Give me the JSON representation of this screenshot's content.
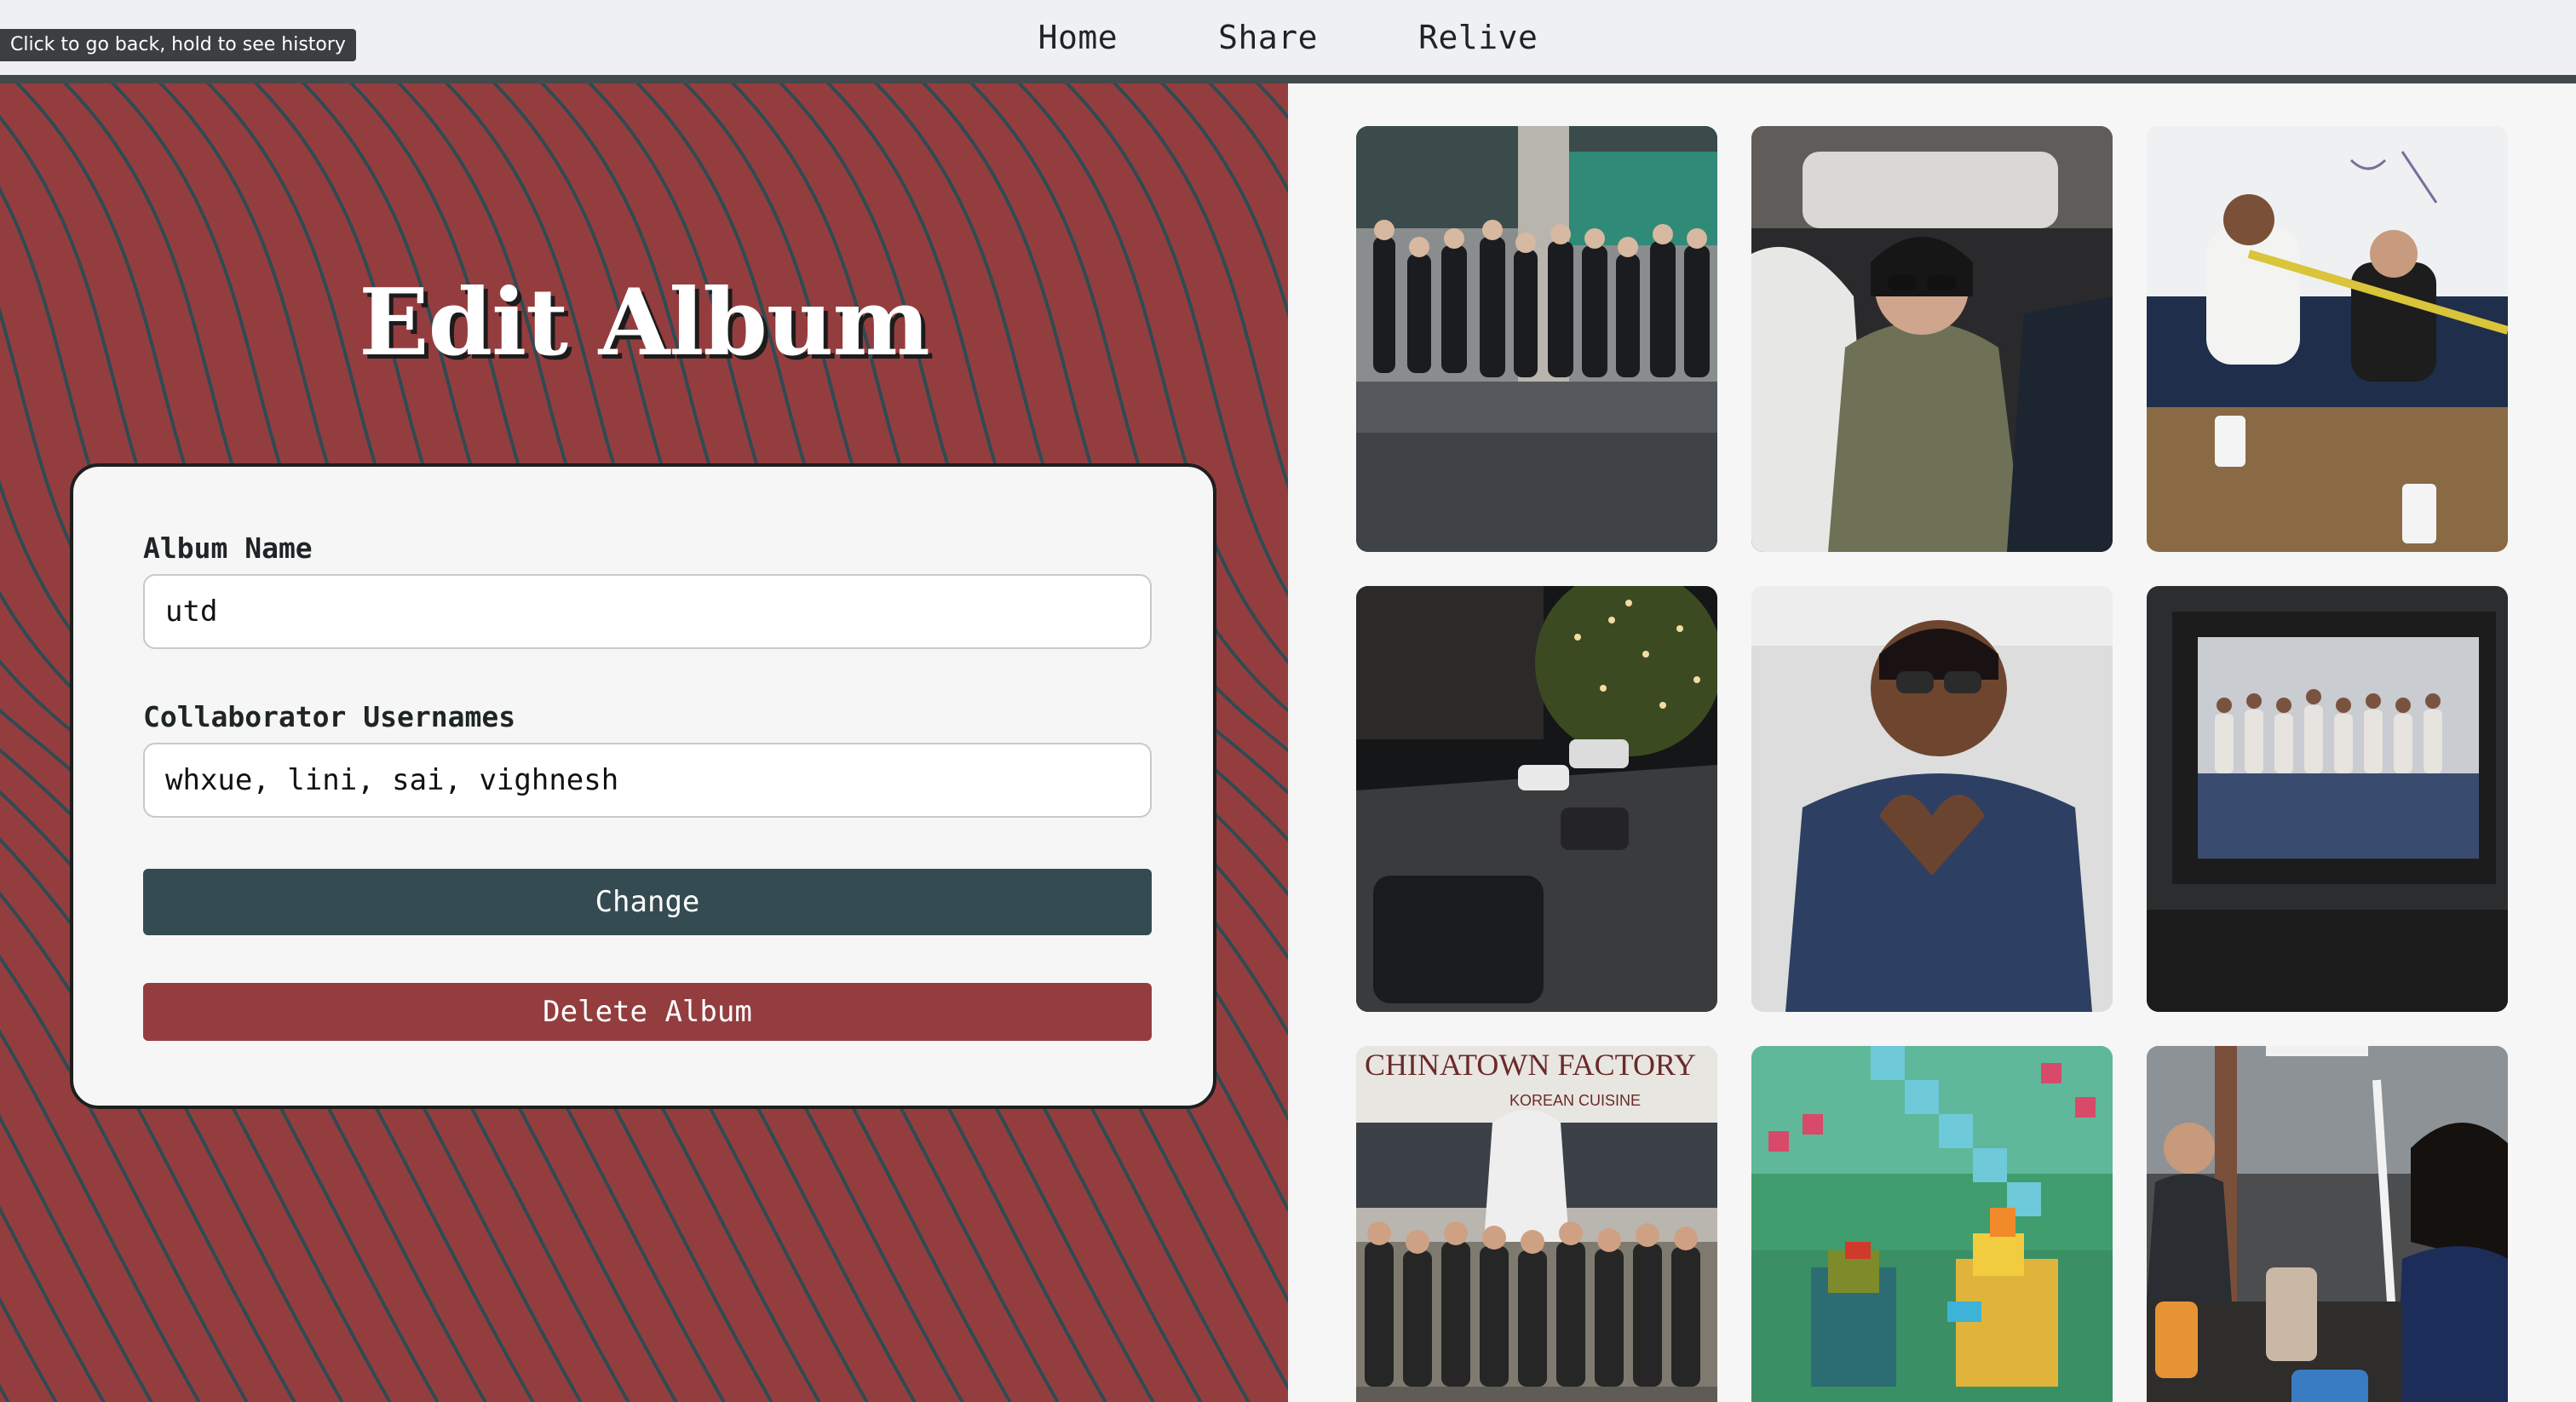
{
  "browser": {
    "back_tooltip": "Click to go back, hold to see history"
  },
  "nav": {
    "items": [
      {
        "label": "Home"
      },
      {
        "label": "Share"
      },
      {
        "label": "Relive"
      }
    ]
  },
  "form": {
    "title": "Edit Album",
    "album_name_label": "Album Name",
    "album_name_value": "utd",
    "collaborators_label": "Collaborator Usernames",
    "collaborators_value": "whxue, lini, sai, vighnesh",
    "change_button": "Change",
    "delete_button": "Delete Album"
  },
  "gallery": {
    "photos": [
      {
        "icon": "group-photo-hallway"
      },
      {
        "icon": "selfie-in-car"
      },
      {
        "icon": "friends-on-couch"
      },
      {
        "icon": "street-at-night"
      },
      {
        "icon": "heart-hands-selfie"
      },
      {
        "icon": "framed-group-photo"
      },
      {
        "icon": "group-photo-chinatown",
        "sign_text": "CHINATOWN FACTORY KOREAN CUISINE"
      },
      {
        "icon": "minecraft-chickens"
      },
      {
        "icon": "cafe-selfie"
      }
    ]
  },
  "colors": {
    "panel_red": "#943d3f",
    "wave_line": "#2f4b52",
    "button_teal": "#344c51",
    "nav_bg": "#eef0f1",
    "nav_border": "#434a4c"
  }
}
